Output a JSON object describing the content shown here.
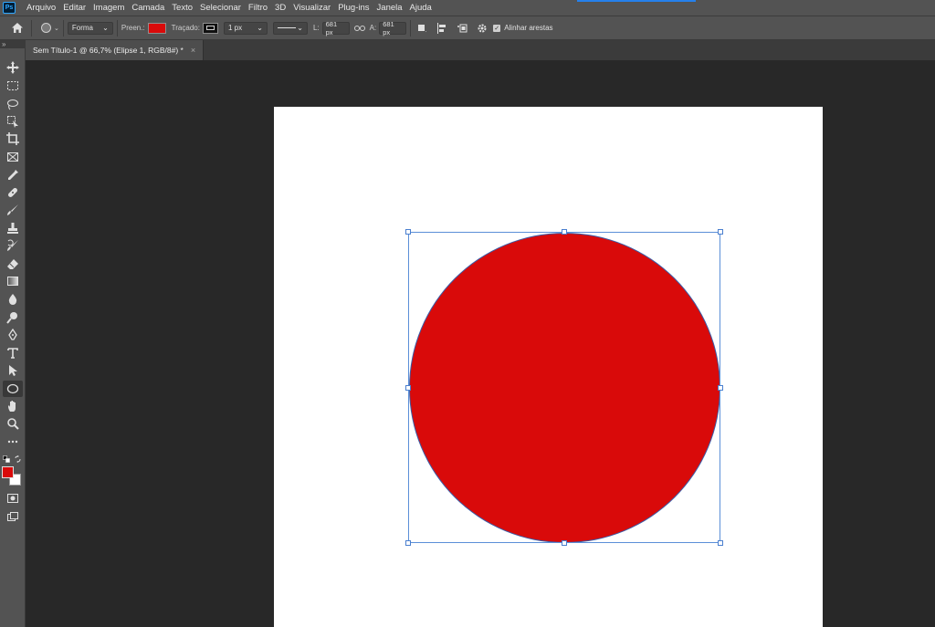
{
  "app": {
    "logo": "Ps"
  },
  "menu": [
    "Arquivo",
    "Editar",
    "Imagem",
    "Camada",
    "Texto",
    "Selecionar",
    "Filtro",
    "3D",
    "Visualizar",
    "Plug-ins",
    "Janela",
    "Ajuda"
  ],
  "options": {
    "mode": "Forma",
    "fill_label": "Preen.:",
    "fill_color": "#d90a0a",
    "stroke_label": "Traçado:",
    "stroke_width": "1 px",
    "width_label": "L:",
    "width_value": "681 px",
    "height_label": "A:",
    "height_value": "681 px",
    "align_edges_label": "Alinhar arestas",
    "align_edges_checked": true
  },
  "document": {
    "tab_title": "Sem Título-1 @ 66,7% (Elipse 1, RGB/8#) *",
    "close_glyph": "×",
    "shape_color": "#d90a0a",
    "canvas_color": "#ffffff"
  },
  "colors": {
    "foreground": "#d90a0a",
    "background": "#ffffff"
  },
  "tools": [
    "move-tool",
    "marquee-tool",
    "lasso-tool",
    "object-selection-tool",
    "crop-tool",
    "frame-tool",
    "eyedropper-tool",
    "healing-brush-tool",
    "brush-tool",
    "clone-stamp-tool",
    "history-brush-tool",
    "eraser-tool",
    "gradient-tool",
    "blur-tool",
    "dodge-tool",
    "pen-tool",
    "type-tool",
    "path-selection-tool",
    "ellipse-tool",
    "hand-tool",
    "zoom-tool",
    "more-tools"
  ]
}
